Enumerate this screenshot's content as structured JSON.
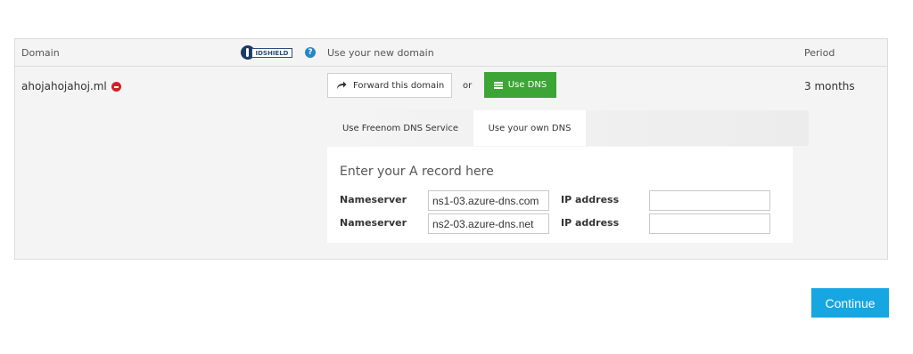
{
  "header": {
    "domain_label": "Domain",
    "idshield_text": "IDSHIELD",
    "help_glyph": "?",
    "use_domain_label": "Use your new domain",
    "period_label": "Period"
  },
  "row": {
    "domain": "ahojahojahoj.ml",
    "period": "3 months",
    "forward_label": "Forward this domain",
    "or_label": "or",
    "use_dns_label": "Use DNS"
  },
  "tabs": [
    {
      "label": "Use Freenom DNS Service",
      "active": false
    },
    {
      "label": "Use your own DNS",
      "active": true
    }
  ],
  "dns": {
    "heading": "Enter your A record here",
    "rows": [
      {
        "ns_label": "Nameserver",
        "ns_value": "ns1-03.azure-dns.com",
        "ip_label": "IP address",
        "ip_value": ""
      },
      {
        "ns_label": "Nameserver",
        "ns_value": "ns2-03.azure-dns.net",
        "ip_label": "IP address",
        "ip_value": ""
      }
    ]
  },
  "continue_label": "Continue",
  "colors": {
    "accent_blue": "#16a6e2",
    "dns_green": "#3ca535",
    "remove_red": "#d0202a",
    "help_blue": "#2487c8"
  },
  "icons": [
    "idshield-logo-icon",
    "help-icon",
    "remove-icon",
    "forward-arrow-icon",
    "list-icon"
  ]
}
